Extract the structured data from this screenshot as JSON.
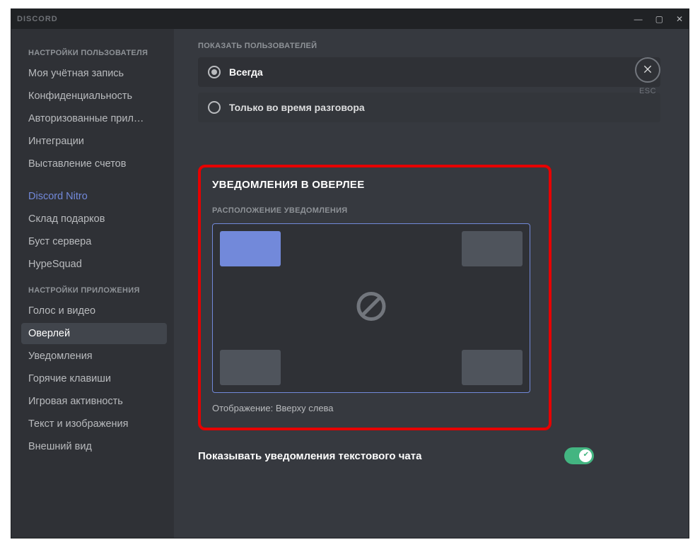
{
  "app": {
    "name": "DISCORD"
  },
  "win": {
    "min": "—",
    "max": "▢",
    "close": "✕"
  },
  "close_esc": {
    "label": "ESC"
  },
  "sidebar": {
    "header_user": "НАСТРОЙКИ ПОЛЬЗОВАТЕЛЯ",
    "user_items": [
      "Моя учётная запись",
      "Конфиденциальность",
      "Авторизованные прил…",
      "Интеграции",
      "Выставление счетов"
    ],
    "nitro_items": [
      "Discord Nitro",
      "Склад подарков",
      "Буст сервера",
      "HypeSquad"
    ],
    "header_app": "НАСТРОЙКИ ПРИЛОЖЕНИЯ",
    "app_items": [
      "Голос и видео",
      "Оверлей",
      "Уведомления",
      "Горячие клавиши",
      "Игровая активность",
      "Текст и изображения",
      "Внешний вид"
    ],
    "active_app_index": 1
  },
  "show_users": {
    "label": "ПОКАЗАТЬ ПОЛЬЗОВАТЕЛЕЙ",
    "option_always": "Всегда",
    "option_talking": "Только во время разговора"
  },
  "overlay_notifications": {
    "title": "УВЕДОМЛЕНИЯ В ОВЕРЛЕЕ",
    "position_label": "РАСПОЛОЖЕНИЕ УВЕДОМЛЕНИЯ",
    "display_text": "Отображение: Вверху слева",
    "selected_corner": "top-left"
  },
  "text_chat_toggle": {
    "label": "Показывать уведомления текстового чата",
    "enabled": true
  }
}
